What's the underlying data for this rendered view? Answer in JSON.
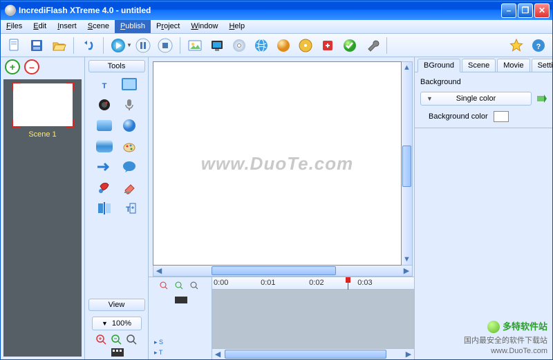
{
  "window": {
    "title": "IncrediFlash XTreme 4.0 - untitled"
  },
  "menu": {
    "files": "Files",
    "edit": "Edit",
    "insert": "Insert",
    "scene": "Scene",
    "publish": "Publish",
    "project": "Project",
    "window": "Window",
    "help": "Help"
  },
  "scenes": {
    "s1": "Scene 1"
  },
  "panels": {
    "tools": "Tools",
    "view": "View"
  },
  "zoom": {
    "value": "100%"
  },
  "watermark": "www.DuoTe.com",
  "timeline": {
    "t0": "0:00",
    "t1": "0:01",
    "t2": "0:02",
    "t3": "0:03"
  },
  "tabs": {
    "bground": "BGround",
    "scene": "Scene",
    "movie": "Movie",
    "setting": "Setting"
  },
  "props": {
    "heading": "Background",
    "mode": "Single color",
    "bgcolor_label": "Background color"
  },
  "branding": {
    "name": "多特软件站",
    "site": "国内最安全的软件下载站",
    "domain": "www.DuoTe.com"
  },
  "icons": {
    "new": "new-document",
    "open": "open-folder",
    "save": "save-disk",
    "play": "play",
    "pause": "pause",
    "stop": "stop",
    "img": "image",
    "screen": "screen",
    "cd": "cd",
    "globe": "globe",
    "ball": "sphere",
    "disc": "disc-gold",
    "export": "export-red",
    "check": "check-ball",
    "wrench": "wrench",
    "star": "star",
    "qm": "question"
  }
}
